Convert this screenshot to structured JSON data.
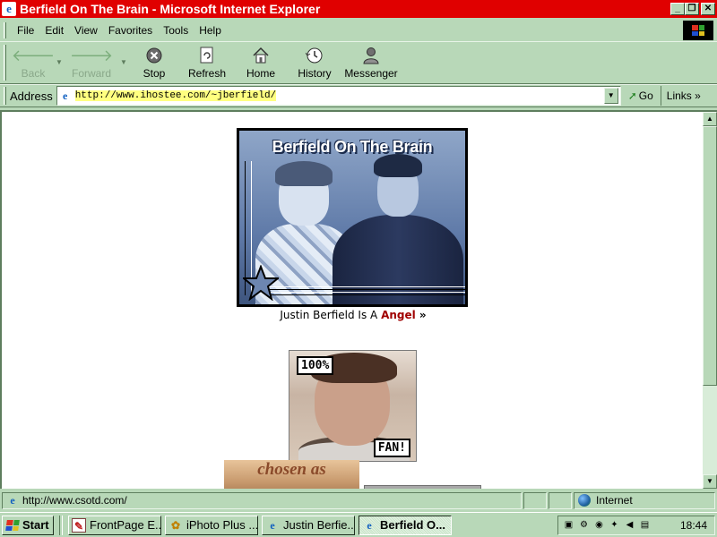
{
  "window": {
    "title": "Berfield On The Brain - Microsoft Internet Explorer",
    "min_glyph": "_",
    "max_glyph": "❐",
    "close_glyph": "✕"
  },
  "menu": {
    "items": [
      {
        "label": "File"
      },
      {
        "label": "Edit"
      },
      {
        "label": "View"
      },
      {
        "label": "Favorites"
      },
      {
        "label": "Tools"
      },
      {
        "label": "Help"
      }
    ]
  },
  "toolbar": {
    "back": {
      "label": "Back",
      "icon": "back-arrow-icon"
    },
    "forward": {
      "label": "Forward",
      "icon": "forward-arrow-icon"
    },
    "stop": {
      "label": "Stop",
      "icon": "stop-icon"
    },
    "refresh": {
      "label": "Refresh",
      "icon": "refresh-icon"
    },
    "home": {
      "label": "Home",
      "icon": "home-icon"
    },
    "history": {
      "label": "History",
      "icon": "history-icon"
    },
    "messenger": {
      "label": "Messenger",
      "icon": "messenger-icon"
    }
  },
  "address": {
    "label": "Address",
    "url_prefix": "http://www.ihostee.com/~jberfield/",
    "go_label": "Go",
    "links_label": "Links",
    "links_chevron": "»"
  },
  "page": {
    "banner_title": "Berfield On The Brain",
    "caption_prefix": "Justin Berfield Is A ",
    "caption_link": "Angel",
    "caption_suffix": " »",
    "fan_top": "100%",
    "fan_bottom": "FAN!",
    "chosen_text": "chosen as"
  },
  "status": {
    "text": "http://www.csotd.com/",
    "zone": "Internet"
  },
  "taskbar": {
    "start_label": "Start",
    "tasks": [
      {
        "label": "FrontPage E...",
        "icon": "frontpage-icon",
        "active": false
      },
      {
        "label": "iPhoto Plus ...",
        "icon": "iphoto-icon",
        "active": false
      },
      {
        "label": "Justin Berfie...",
        "icon": "ie-icon",
        "active": false
      },
      {
        "label": "Berfield O...",
        "icon": "ie-icon",
        "active": true
      }
    ],
    "clock": "18:44"
  },
  "colors": {
    "titlebar": "#e00000",
    "chrome": "#b8d8b8",
    "link": "#a00000"
  }
}
